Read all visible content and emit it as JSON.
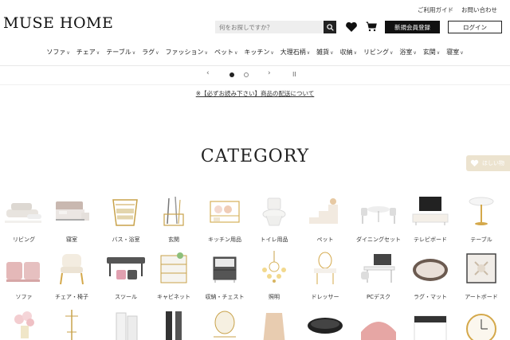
{
  "header": {
    "logo": "MUSE HOME",
    "links": [
      "ご利用ガイド",
      "お問い合わせ"
    ],
    "search_placeholder": "何をお探しですか？",
    "register_label": "新規会員登録",
    "login_label": "ログイン"
  },
  "nav": [
    "ソファ",
    "チェア",
    "テーブル",
    "ラグ",
    "ファッション",
    "ペット",
    "キッチン",
    "大理石柄",
    "雑貨",
    "収納",
    "リビング",
    "浴室",
    "玄関",
    "寝室"
  ],
  "slider": {
    "prev": "‹",
    "next": "›",
    "pause": "II"
  },
  "notice": "※【必ずお読み下さい】商品の配送について",
  "category": {
    "title": "CATEGORY",
    "row1": [
      "リビング",
      "寝室",
      "バス・浴室",
      "玄関",
      "キッチン用品",
      "トイレ用品",
      "ペット",
      "ダイニングセット",
      "テレビボード",
      "テーブル"
    ],
    "row2": [
      "ソファ",
      "チェア・椅子",
      "スツール",
      "キャビネット",
      "収納・チェスト",
      "照明",
      "ドレッサー",
      "PCデスク",
      "ラグ・マット",
      "アートボード"
    ]
  },
  "wishlist": {
    "label": "ほしい物"
  },
  "colors": {
    "brand": "#111111",
    "accent": "#ece3cf"
  }
}
